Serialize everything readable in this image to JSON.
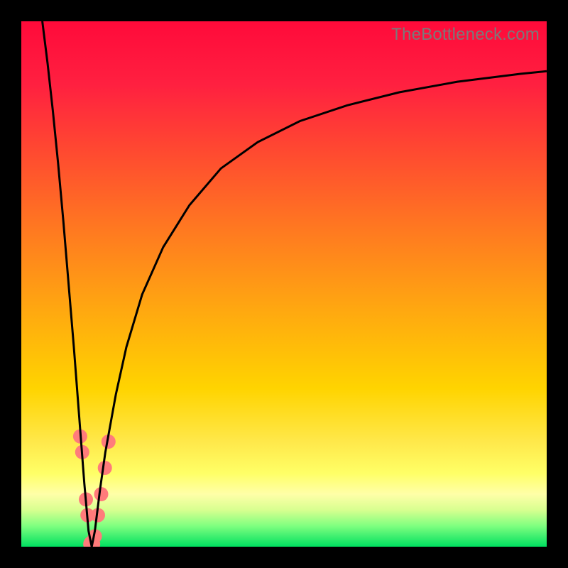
{
  "watermark": "TheBottleneck.com",
  "chart_data": {
    "type": "line",
    "title": "",
    "xlabel": "",
    "ylabel": "",
    "xlim": [
      0,
      100
    ],
    "ylim": [
      0,
      100
    ],
    "grid": false,
    "background_gradient": {
      "stops": [
        {
          "pos": 0.0,
          "color": "#ff0a3a"
        },
        {
          "pos": 0.12,
          "color": "#ff2040"
        },
        {
          "pos": 0.25,
          "color": "#ff4a30"
        },
        {
          "pos": 0.4,
          "color": "#ff7a20"
        },
        {
          "pos": 0.55,
          "color": "#ffa810"
        },
        {
          "pos": 0.7,
          "color": "#ffd400"
        },
        {
          "pos": 0.8,
          "color": "#ffe84a"
        },
        {
          "pos": 0.86,
          "color": "#ffff66"
        },
        {
          "pos": 0.9,
          "color": "#ffffa8"
        },
        {
          "pos": 0.93,
          "color": "#d8ff90"
        },
        {
          "pos": 0.96,
          "color": "#80ff80"
        },
        {
          "pos": 1.0,
          "color": "#00e060"
        }
      ]
    },
    "series": [
      {
        "name": "bottleneck-curve",
        "color": "#000000",
        "x": [
          4,
          5,
          6,
          7,
          8,
          9,
          10,
          11,
          12,
          12.8,
          13.4,
          14,
          15,
          16,
          18,
          20,
          23,
          27,
          32,
          38,
          45,
          53,
          62,
          72,
          83,
          95,
          100
        ],
        "y": [
          100,
          92,
          83,
          73,
          62,
          50,
          38,
          25,
          12,
          3,
          0,
          3,
          11,
          18,
          29,
          38,
          48,
          57,
          65,
          72,
          77,
          81,
          84,
          86.5,
          88.5,
          90,
          90.5
        ]
      }
    ],
    "markers": [
      {
        "name": "marker",
        "color": "#ff7b7b",
        "r": 10,
        "x": 11.2,
        "y": 21
      },
      {
        "name": "marker",
        "color": "#ff7b7b",
        "r": 10,
        "x": 11.6,
        "y": 18
      },
      {
        "name": "marker",
        "color": "#ff7b7b",
        "r": 10,
        "x": 12.3,
        "y": 9
      },
      {
        "name": "marker",
        "color": "#ff7b7b",
        "r": 10,
        "x": 12.6,
        "y": 6
      },
      {
        "name": "marker",
        "color": "#ff7b7b",
        "r": 12,
        "x": 13.4,
        "y": 0.5
      },
      {
        "name": "marker",
        "color": "#ff7b7b",
        "r": 10,
        "x": 14.0,
        "y": 2
      },
      {
        "name": "marker",
        "color": "#ff7b7b",
        "r": 10,
        "x": 14.6,
        "y": 6
      },
      {
        "name": "marker",
        "color": "#ff7b7b",
        "r": 10,
        "x": 15.2,
        "y": 10
      },
      {
        "name": "marker",
        "color": "#ff7b7b",
        "r": 10,
        "x": 15.9,
        "y": 15
      },
      {
        "name": "marker",
        "color": "#ff7b7b",
        "r": 10,
        "x": 16.6,
        "y": 20
      }
    ]
  }
}
